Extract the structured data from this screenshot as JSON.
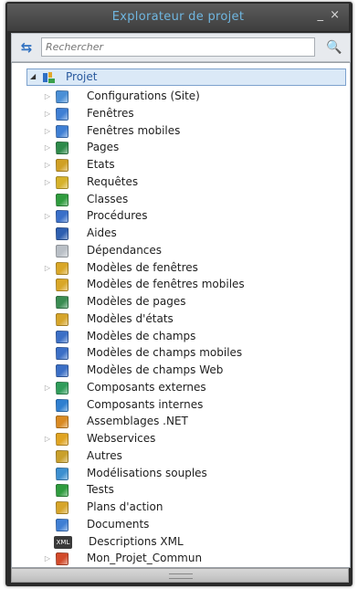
{
  "window": {
    "title": "Explorateur de projet",
    "minimize_glyph": "_",
    "close_glyph": "×"
  },
  "toolbar": {
    "sync_glyph": "⇆",
    "search_placeholder": "Rechercher",
    "find_glyph": "🔍"
  },
  "tree": {
    "root": {
      "label": "Projet",
      "icon": "project-icon",
      "expand_glyph": "◢"
    },
    "items": [
      {
        "label": "Configurations (Site)",
        "icon": "configuration-icon",
        "expandable": true,
        "color": "#4a8fd6"
      },
      {
        "label": "Fenêtres",
        "icon": "window-icon",
        "expandable": true,
        "color": "#3f7fd4"
      },
      {
        "label": "Fenêtres mobiles",
        "icon": "mobile-window-icon",
        "expandable": true,
        "color": "#3f7fd4"
      },
      {
        "label": "Pages",
        "icon": "page-icon",
        "expandable": true,
        "color": "#2e8a4a"
      },
      {
        "label": "Etats",
        "icon": "report-icon",
        "expandable": true,
        "color": "#d0a025"
      },
      {
        "label": "Requêtes",
        "icon": "query-icon",
        "expandable": true,
        "color": "#d6b22a"
      },
      {
        "label": "Classes",
        "icon": "class-icon",
        "expandable": false,
        "color": "#2f9c3e"
      },
      {
        "label": "Procédures",
        "icon": "procedure-icon",
        "expandable": true,
        "color": "#3a6fc9"
      },
      {
        "label": "Aides",
        "icon": "help-icon",
        "expandable": false,
        "color": "#2e5fb0"
      },
      {
        "label": "Dépendances",
        "icon": "dependency-icon",
        "expandable": false,
        "color": "#b9bfc6"
      },
      {
        "label": "Modèles de fenêtres",
        "icon": "window-template-icon",
        "expandable": true,
        "color": "#d9a728"
      },
      {
        "label": "Modèles de fenêtres mobiles",
        "icon": "mobile-window-template-icon",
        "expandable": false,
        "color": "#d9a728"
      },
      {
        "label": "Modèles de pages",
        "icon": "page-template-icon",
        "expandable": false,
        "color": "#3a8c52"
      },
      {
        "label": "Modèles d'états",
        "icon": "report-template-icon",
        "expandable": false,
        "color": "#d6a52a"
      },
      {
        "label": "Modèles de champs",
        "icon": "control-template-icon",
        "expandable": false,
        "color": "#3b6fc6"
      },
      {
        "label": "Modèles de champs mobiles",
        "icon": "mobile-control-template-icon",
        "expandable": false,
        "color": "#3b6fc6"
      },
      {
        "label": "Modèles de champs Web",
        "icon": "web-control-template-icon",
        "expandable": false,
        "color": "#3b6fc6"
      },
      {
        "label": "Composants externes",
        "icon": "external-component-icon",
        "expandable": true,
        "color": "#2f9c5a"
      },
      {
        "label": "Composants internes",
        "icon": "internal-component-icon",
        "expandable": false,
        "color": "#2f7fd0"
      },
      {
        "label": "Assemblages .NET",
        "icon": "dotnet-assembly-icon",
        "expandable": false,
        "color": "#d98a22"
      },
      {
        "label": "Webservices",
        "icon": "webservice-icon",
        "expandable": true,
        "color": "#e0a422"
      },
      {
        "label": "Autres",
        "icon": "other-icon",
        "expandable": false,
        "color": "#c9a02c"
      },
      {
        "label": "Modélisations souples",
        "icon": "flexible-modeling-icon",
        "expandable": false,
        "color": "#3c8fd0"
      },
      {
        "label": "Tests",
        "icon": "test-icon",
        "expandable": false,
        "color": "#2f9c3e"
      },
      {
        "label": "Plans d'action",
        "icon": "action-plan-icon",
        "expandable": false,
        "color": "#d6a52a"
      },
      {
        "label": "Documents",
        "icon": "document-icon",
        "expandable": false,
        "color": "#3f7fd4"
      },
      {
        "label": "Descriptions XML",
        "icon": "xml-icon",
        "expandable": false,
        "color": "#3a3a3a",
        "badge": "XML"
      },
      {
        "label": "Mon_Projet_Commun",
        "icon": "shared-project-icon",
        "expandable": true,
        "color": "#d24a2a"
      }
    ]
  }
}
